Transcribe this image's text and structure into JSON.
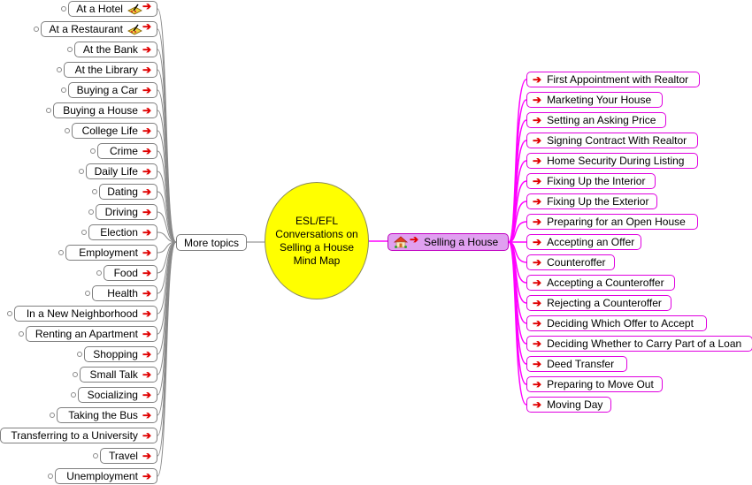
{
  "central_topic": {
    "lines": [
      "ESL/EFL",
      "Conversations on",
      "Selling a House",
      "Mind Map"
    ],
    "color": "#ffff00"
  },
  "more_topics": {
    "label": "More topics",
    "items": [
      {
        "label": "At a Hotel",
        "icon": "hotel-bell-icon"
      },
      {
        "label": "At a Restaurant",
        "icon": "hotel-bell-icon"
      },
      {
        "label": "At the Bank"
      },
      {
        "label": "At the Library"
      },
      {
        "label": "Buying a Car"
      },
      {
        "label": "Buying a House"
      },
      {
        "label": "College Life"
      },
      {
        "label": "Crime"
      },
      {
        "label": "Daily Life"
      },
      {
        "label": "Dating"
      },
      {
        "label": "Driving"
      },
      {
        "label": "Election"
      },
      {
        "label": "Employment"
      },
      {
        "label": "Food"
      },
      {
        "label": "Health"
      },
      {
        "label": "In a New Neighborhood"
      },
      {
        "label": "Renting an Apartment"
      },
      {
        "label": "Shopping"
      },
      {
        "label": "Small Talk"
      },
      {
        "label": "Socializing"
      },
      {
        "label": "Taking the Bus"
      },
      {
        "label": "Transferring to a University"
      },
      {
        "label": "Travel"
      },
      {
        "label": "Unemployment"
      }
    ]
  },
  "main_branch": {
    "label": "Selling a House",
    "icon": "house-icon",
    "color": "#e0a0f0",
    "line_color": "#ff00ff",
    "items": [
      "First Appointment with Realtor",
      "Marketing Your House",
      "Setting an Asking Price",
      "Signing Contract With Realtor",
      "Home Security During Listing",
      "Fixing Up the Interior",
      "Fixing Up the Exterior",
      "Preparing for an Open House",
      "Accepting an Offer",
      "Counteroffer",
      "Accepting a Counteroffer",
      "Rejecting a Counteroffer",
      "Deciding Which Offer to Accept",
      "Deciding Whether to Carry Part of a Loan",
      "Deed Transfer",
      "Preparing to Move Out",
      "Moving Day"
    ]
  },
  "link_arrow": "➔"
}
